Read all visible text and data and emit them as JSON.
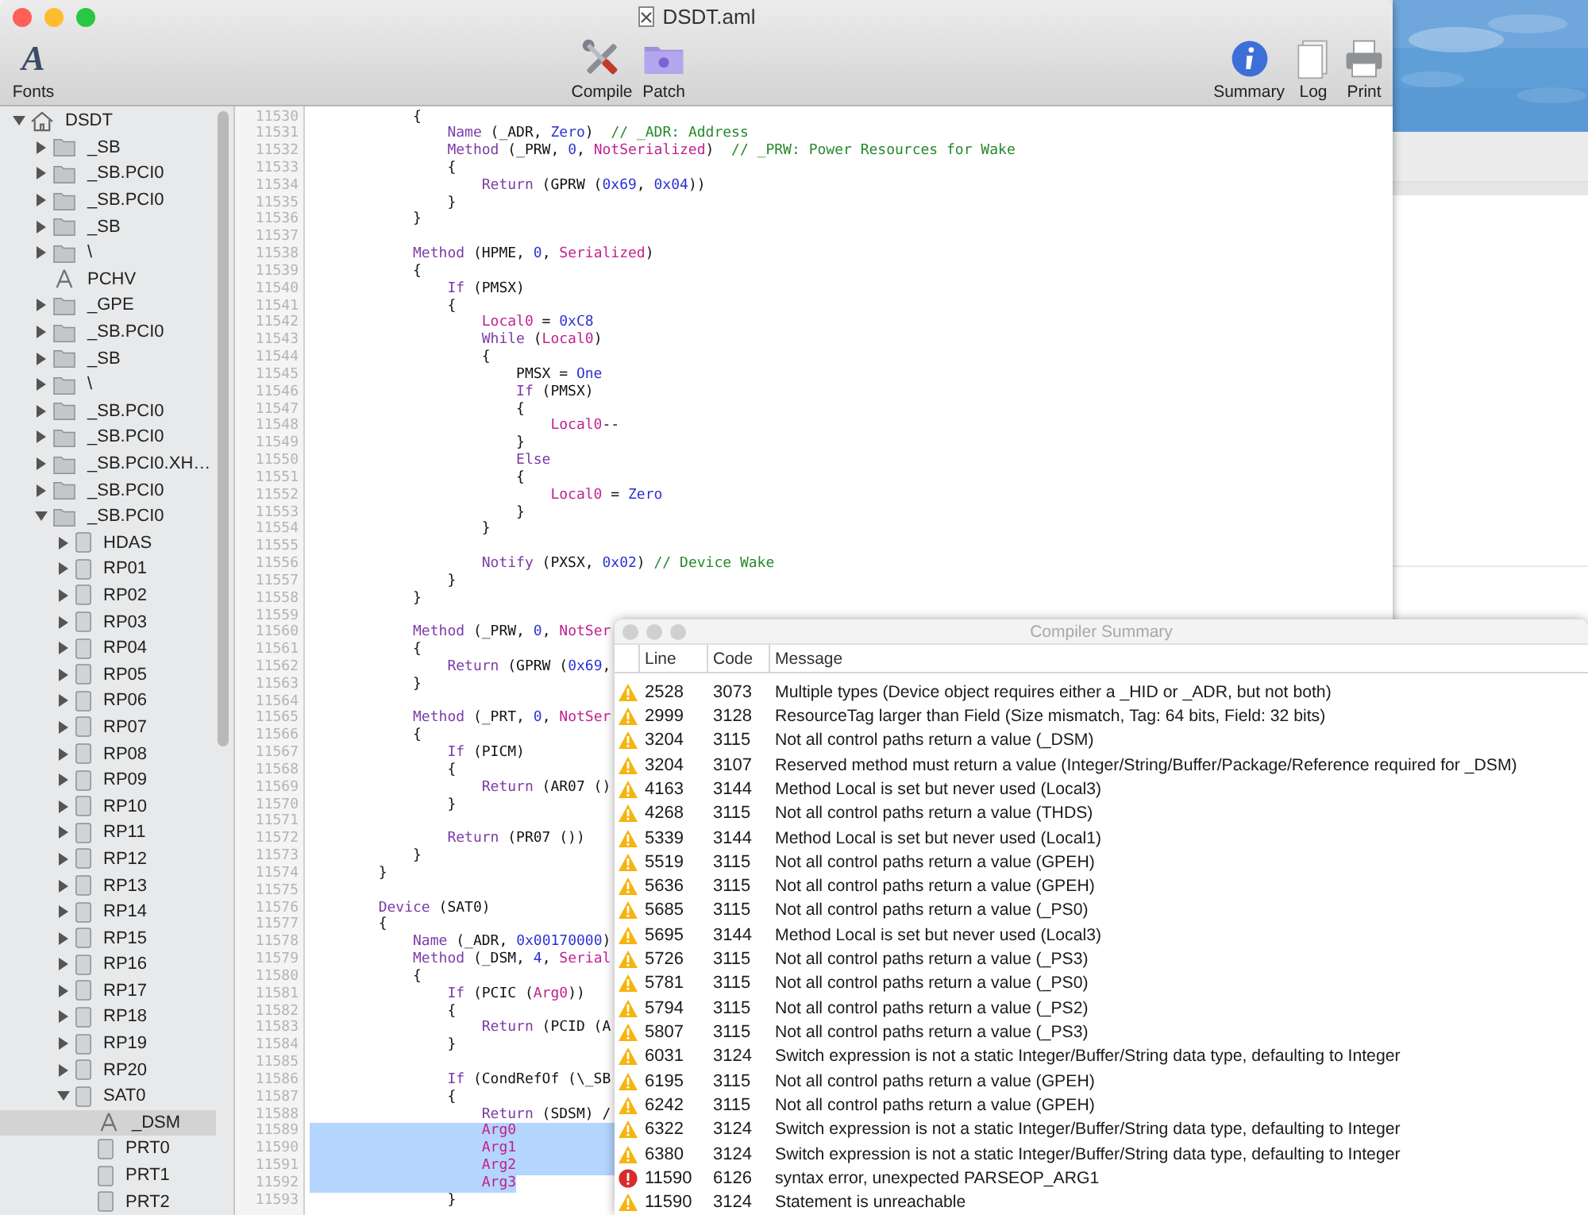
{
  "window": {
    "title": "DSDT.aml",
    "active": true
  },
  "toolbar": {
    "left": [
      {
        "kind": "fonts",
        "glyph": "A",
        "label": "Fonts"
      }
    ],
    "center": [
      {
        "kind": "compile",
        "label": "Compile"
      },
      {
        "kind": "patch",
        "label": "Patch"
      }
    ],
    "right": [
      {
        "kind": "summary",
        "label": "Summary"
      },
      {
        "kind": "log",
        "label": "Log"
      },
      {
        "kind": "print",
        "label": "Print"
      }
    ]
  },
  "sidebar": {
    "items": [
      {
        "label": "DSDT",
        "kind": "root",
        "expanded": true,
        "selected": false,
        "children": [
          {
            "label": "_SB",
            "kind": "folder",
            "expanded": false,
            "selected": false
          },
          {
            "label": "_SB.PCI0",
            "kind": "folder",
            "expanded": false,
            "selected": false
          },
          {
            "label": "_SB.PCI0",
            "kind": "folder",
            "expanded": false,
            "selected": false
          },
          {
            "label": "_SB",
            "kind": "folder",
            "expanded": false,
            "selected": false
          },
          {
            "label": "\\",
            "kind": "folder",
            "expanded": false,
            "selected": false
          },
          {
            "label": "PCHV",
            "kind": "method",
            "selected": false
          },
          {
            "label": "_GPE",
            "kind": "folder",
            "expanded": false,
            "selected": false
          },
          {
            "label": "_SB.PCI0",
            "kind": "folder",
            "expanded": false,
            "selected": false
          },
          {
            "label": "_SB",
            "kind": "folder",
            "expanded": false,
            "selected": false
          },
          {
            "label": "\\",
            "kind": "folder",
            "expanded": false,
            "selected": false
          },
          {
            "label": "_SB.PCI0",
            "kind": "folder",
            "expanded": false,
            "selected": false
          },
          {
            "label": "_SB.PCI0",
            "kind": "folder",
            "expanded": false,
            "selected": false
          },
          {
            "label": "_SB.PCI0.XH…",
            "kind": "folder",
            "expanded": false,
            "selected": false
          },
          {
            "label": "_SB.PCI0",
            "kind": "folder",
            "expanded": false,
            "selected": false
          },
          {
            "label": "_SB.PCI0",
            "kind": "folder",
            "expanded": true,
            "selected": false,
            "children": [
              {
                "label": "HDAS",
                "kind": "device",
                "expanded": false,
                "selected": false
              },
              {
                "label": "RP01",
                "kind": "device",
                "expanded": false,
                "selected": false
              },
              {
                "label": "RP02",
                "kind": "device",
                "expanded": false,
                "selected": false
              },
              {
                "label": "RP03",
                "kind": "device",
                "expanded": false,
                "selected": false
              },
              {
                "label": "RP04",
                "kind": "device",
                "expanded": false,
                "selected": false
              },
              {
                "label": "RP05",
                "kind": "device",
                "expanded": false,
                "selected": false
              },
              {
                "label": "RP06",
                "kind": "device",
                "expanded": false,
                "selected": false
              },
              {
                "label": "RP07",
                "kind": "device",
                "expanded": false,
                "selected": false
              },
              {
                "label": "RP08",
                "kind": "device",
                "expanded": false,
                "selected": false
              },
              {
                "label": "RP09",
                "kind": "device",
                "expanded": false,
                "selected": false
              },
              {
                "label": "RP10",
                "kind": "device",
                "expanded": false,
                "selected": false
              },
              {
                "label": "RP11",
                "kind": "device",
                "expanded": false,
                "selected": false
              },
              {
                "label": "RP12",
                "kind": "device",
                "expanded": false,
                "selected": false
              },
              {
                "label": "RP13",
                "kind": "device",
                "expanded": false,
                "selected": false
              },
              {
                "label": "RP14",
                "kind": "device",
                "expanded": false,
                "selected": false
              },
              {
                "label": "RP15",
                "kind": "device",
                "expanded": false,
                "selected": false
              },
              {
                "label": "RP16",
                "kind": "device",
                "expanded": false,
                "selected": false
              },
              {
                "label": "RP17",
                "kind": "device",
                "expanded": false,
                "selected": false
              },
              {
                "label": "RP18",
                "kind": "device",
                "expanded": false,
                "selected": false
              },
              {
                "label": "RP19",
                "kind": "device",
                "expanded": false,
                "selected": false
              },
              {
                "label": "RP20",
                "kind": "device",
                "expanded": false,
                "selected": false
              },
              {
                "label": "SAT0",
                "kind": "device",
                "expanded": true,
                "selected": false,
                "children": [
                  {
                    "label": "_DSM",
                    "kind": "method",
                    "selected": true
                  },
                  {
                    "label": "PRT0",
                    "kind": "device",
                    "selected": false
                  },
                  {
                    "label": "PRT1",
                    "kind": "device",
                    "selected": false
                  },
                  {
                    "label": "PRT2",
                    "kind": "device",
                    "selected": false
                  }
                ]
              }
            ]
          }
        ]
      }
    ]
  },
  "editor": {
    "lines": [
      {
        "number": "11530",
        "selected": false,
        "tokens": [
          {
            "kind": "plain",
            "text": "            {"
          }
        ]
      },
      {
        "number": "11531",
        "selected": false,
        "tokens": [
          {
            "kind": "keyword",
            "text": "                Name"
          },
          {
            "kind": "plain",
            "text": " (_ADR, "
          },
          {
            "kind": "number",
            "text": "Zero"
          },
          {
            "kind": "plain",
            "text": ")  "
          },
          {
            "kind": "comment",
            "text": "// _ADR: Address"
          }
        ]
      },
      {
        "number": "11532",
        "selected": false,
        "tokens": [
          {
            "kind": "keyword",
            "text": "                Method"
          },
          {
            "kind": "plain",
            "text": " (_PRW, "
          },
          {
            "kind": "number",
            "text": "0"
          },
          {
            "kind": "plain",
            "text": ", "
          },
          {
            "kind": "variable",
            "text": "NotSerialized"
          },
          {
            "kind": "plain",
            "text": ")  "
          },
          {
            "kind": "comment",
            "text": "// _PRW: Power Resources for Wake"
          }
        ]
      },
      {
        "number": "11533",
        "selected": false,
        "tokens": [
          {
            "kind": "plain",
            "text": "                {"
          }
        ]
      },
      {
        "number": "11534",
        "selected": false,
        "tokens": [
          {
            "kind": "keyword",
            "text": "                    Return"
          },
          {
            "kind": "plain",
            "text": " (GPRW ("
          },
          {
            "kind": "number",
            "text": "0x69"
          },
          {
            "kind": "plain",
            "text": ", "
          },
          {
            "kind": "number",
            "text": "0x04"
          },
          {
            "kind": "plain",
            "text": "))"
          }
        ]
      },
      {
        "number": "11535",
        "selected": false,
        "tokens": [
          {
            "kind": "plain",
            "text": "                }"
          }
        ]
      },
      {
        "number": "11536",
        "selected": false,
        "tokens": [
          {
            "kind": "plain",
            "text": "            }"
          }
        ]
      },
      {
        "number": "11537",
        "selected": false
      },
      {
        "number": "11538",
        "selected": false,
        "tokens": [
          {
            "kind": "keyword",
            "text": "            Method"
          },
          {
            "kind": "plain",
            "text": " (HPME, "
          },
          {
            "kind": "number",
            "text": "0"
          },
          {
            "kind": "plain",
            "text": ", "
          },
          {
            "kind": "variable",
            "text": "Serialized"
          },
          {
            "kind": "plain",
            "text": ")"
          }
        ]
      },
      {
        "number": "11539",
        "selected": false,
        "tokens": [
          {
            "kind": "plain",
            "text": "            {"
          }
        ]
      },
      {
        "number": "11540",
        "selected": false,
        "tokens": [
          {
            "kind": "keyword",
            "text": "                If"
          },
          {
            "kind": "plain",
            "text": " (PMSX)"
          }
        ]
      },
      {
        "number": "11541",
        "selected": false,
        "tokens": [
          {
            "kind": "plain",
            "text": "                {"
          }
        ]
      },
      {
        "number": "11542",
        "selected": false,
        "tokens": [
          {
            "kind": "variable",
            "text": "                    Local0"
          },
          {
            "kind": "plain",
            "text": " = "
          },
          {
            "kind": "number",
            "text": "0xC8"
          }
        ]
      },
      {
        "number": "11543",
        "selected": false,
        "tokens": [
          {
            "kind": "keyword",
            "text": "                    While"
          },
          {
            "kind": "plain",
            "text": " ("
          },
          {
            "kind": "variable",
            "text": "Local0"
          },
          {
            "kind": "plain",
            "text": ")"
          }
        ]
      },
      {
        "number": "11544",
        "selected": false,
        "tokens": [
          {
            "kind": "plain",
            "text": "                    {"
          }
        ]
      },
      {
        "number": "11545",
        "selected": false,
        "tokens": [
          {
            "kind": "plain",
            "text": "                        PMSX = "
          },
          {
            "kind": "number",
            "text": "One"
          }
        ]
      },
      {
        "number": "11546",
        "selected": false,
        "tokens": [
          {
            "kind": "keyword",
            "text": "                        If"
          },
          {
            "kind": "plain",
            "text": " (PMSX)"
          }
        ]
      },
      {
        "number": "11547",
        "selected": false,
        "tokens": [
          {
            "kind": "plain",
            "text": "                        {"
          }
        ]
      },
      {
        "number": "11548",
        "selected": false,
        "tokens": [
          {
            "kind": "variable",
            "text": "                            Local0"
          },
          {
            "kind": "plain",
            "text": "--"
          }
        ]
      },
      {
        "number": "11549",
        "selected": false,
        "tokens": [
          {
            "kind": "plain",
            "text": "                        }"
          }
        ]
      },
      {
        "number": "11550",
        "selected": false,
        "tokens": [
          {
            "kind": "keyword",
            "text": "                        Else"
          }
        ]
      },
      {
        "number": "11551",
        "selected": false,
        "tokens": [
          {
            "kind": "plain",
            "text": "                        {"
          }
        ]
      },
      {
        "number": "11552",
        "selected": false,
        "tokens": [
          {
            "kind": "variable",
            "text": "                            Local0"
          },
          {
            "kind": "plain",
            "text": " = "
          },
          {
            "kind": "number",
            "text": "Zero"
          }
        ]
      },
      {
        "number": "11553",
        "selected": false,
        "tokens": [
          {
            "kind": "plain",
            "text": "                        }"
          }
        ]
      },
      {
        "number": "11554",
        "selected": false,
        "tokens": [
          {
            "kind": "plain",
            "text": "                    }"
          }
        ]
      },
      {
        "number": "11555",
        "selected": false
      },
      {
        "number": "11556",
        "selected": false,
        "tokens": [
          {
            "kind": "keyword",
            "text": "                    Notify"
          },
          {
            "kind": "plain",
            "text": " (PXSX, "
          },
          {
            "kind": "number",
            "text": "0x02"
          },
          {
            "kind": "plain",
            "text": ") "
          },
          {
            "kind": "comment",
            "text": "// Device Wake"
          }
        ]
      },
      {
        "number": "11557",
        "selected": false,
        "tokens": [
          {
            "kind": "plain",
            "text": "                }"
          }
        ]
      },
      {
        "number": "11558",
        "selected": false,
        "tokens": [
          {
            "kind": "plain",
            "text": "            }"
          }
        ]
      },
      {
        "number": "11559",
        "selected": false
      },
      {
        "number": "11560",
        "selected": false,
        "tokens": [
          {
            "kind": "keyword",
            "text": "            Method"
          },
          {
            "kind": "plain",
            "text": " (_PRW, "
          },
          {
            "kind": "number",
            "text": "0"
          },
          {
            "kind": "plain",
            "text": ", "
          },
          {
            "kind": "variable",
            "text": "NotSer"
          }
        ]
      },
      {
        "number": "11561",
        "selected": false,
        "tokens": [
          {
            "kind": "plain",
            "text": "            {"
          }
        ]
      },
      {
        "number": "11562",
        "selected": false,
        "tokens": [
          {
            "kind": "keyword",
            "text": "                Return"
          },
          {
            "kind": "plain",
            "text": " (GPRW ("
          },
          {
            "kind": "number",
            "text": "0x69"
          },
          {
            "kind": "plain",
            "text": ","
          }
        ]
      },
      {
        "number": "11563",
        "selected": false,
        "tokens": [
          {
            "kind": "plain",
            "text": "            }"
          }
        ]
      },
      {
        "number": "11564",
        "selected": false
      },
      {
        "number": "11565",
        "selected": false,
        "tokens": [
          {
            "kind": "keyword",
            "text": "            Method"
          },
          {
            "kind": "plain",
            "text": " (_PRT, "
          },
          {
            "kind": "number",
            "text": "0"
          },
          {
            "kind": "plain",
            "text": ", "
          },
          {
            "kind": "variable",
            "text": "NotSer"
          }
        ]
      },
      {
        "number": "11566",
        "selected": false,
        "tokens": [
          {
            "kind": "plain",
            "text": "            {"
          }
        ]
      },
      {
        "number": "11567",
        "selected": false,
        "tokens": [
          {
            "kind": "keyword",
            "text": "                If"
          },
          {
            "kind": "plain",
            "text": " (PICM)"
          }
        ]
      },
      {
        "number": "11568",
        "selected": false,
        "tokens": [
          {
            "kind": "plain",
            "text": "                {"
          }
        ]
      },
      {
        "number": "11569",
        "selected": false,
        "tokens": [
          {
            "kind": "keyword",
            "text": "                    Return"
          },
          {
            "kind": "plain",
            "text": " (AR07 ()"
          }
        ]
      },
      {
        "number": "11570",
        "selected": false,
        "tokens": [
          {
            "kind": "plain",
            "text": "                }"
          }
        ]
      },
      {
        "number": "11571",
        "selected": false
      },
      {
        "number": "11572",
        "selected": false,
        "tokens": [
          {
            "kind": "keyword",
            "text": "                Return"
          },
          {
            "kind": "plain",
            "text": " (PR07 ())"
          }
        ]
      },
      {
        "number": "11573",
        "selected": false,
        "tokens": [
          {
            "kind": "plain",
            "text": "            }"
          }
        ]
      },
      {
        "number": "11574",
        "selected": false,
        "tokens": [
          {
            "kind": "plain",
            "text": "        }"
          }
        ]
      },
      {
        "number": "11575",
        "selected": false
      },
      {
        "number": "11576",
        "selected": false,
        "tokens": [
          {
            "kind": "keyword",
            "text": "        Device"
          },
          {
            "kind": "plain",
            "text": " (SAT0)"
          }
        ]
      },
      {
        "number": "11577",
        "selected": false,
        "tokens": [
          {
            "kind": "plain",
            "text": "        {"
          }
        ]
      },
      {
        "number": "11578",
        "selected": false,
        "tokens": [
          {
            "kind": "keyword",
            "text": "            Name"
          },
          {
            "kind": "plain",
            "text": " (_ADR, "
          },
          {
            "kind": "number",
            "text": "0x00170000"
          },
          {
            "kind": "plain",
            "text": ")"
          }
        ]
      },
      {
        "number": "11579",
        "selected": false,
        "tokens": [
          {
            "kind": "keyword",
            "text": "            Method"
          },
          {
            "kind": "plain",
            "text": " (_DSM, "
          },
          {
            "kind": "number",
            "text": "4"
          },
          {
            "kind": "plain",
            "text": ", "
          },
          {
            "kind": "variable",
            "text": "Serial"
          }
        ]
      },
      {
        "number": "11580",
        "selected": false,
        "tokens": [
          {
            "kind": "plain",
            "text": "            {"
          }
        ]
      },
      {
        "number": "11581",
        "selected": false,
        "tokens": [
          {
            "kind": "keyword",
            "text": "                If"
          },
          {
            "kind": "plain",
            "text": " (PCIC ("
          },
          {
            "kind": "variable",
            "text": "Arg0"
          },
          {
            "kind": "plain",
            "text": "))"
          }
        ]
      },
      {
        "number": "11582",
        "selected": false,
        "tokens": [
          {
            "kind": "plain",
            "text": "                {"
          }
        ]
      },
      {
        "number": "11583",
        "selected": false,
        "tokens": [
          {
            "kind": "keyword",
            "text": "                    Return"
          },
          {
            "kind": "plain",
            "text": " (PCID (A"
          }
        ]
      },
      {
        "number": "11584",
        "selected": false,
        "tokens": [
          {
            "kind": "plain",
            "text": "                }"
          }
        ]
      },
      {
        "number": "11585",
        "selected": false
      },
      {
        "number": "11586",
        "selected": false,
        "tokens": [
          {
            "kind": "keyword",
            "text": "                If"
          },
          {
            "kind": "plain",
            "text": " (CondRefOf (\\_SB"
          }
        ]
      },
      {
        "number": "11587",
        "selected": false,
        "tokens": [
          {
            "kind": "plain",
            "text": "                {"
          }
        ]
      },
      {
        "number": "11588",
        "selected": false,
        "tokens": [
          {
            "kind": "keyword",
            "text": "                    Return"
          },
          {
            "kind": "plain",
            "text": " (SDSM) /"
          }
        ]
      },
      {
        "number": "11589",
        "selected": true,
        "tokens": [
          {
            "kind": "variable",
            "text": "                    Arg0"
          }
        ]
      },
      {
        "number": "11590",
        "selected": true,
        "tokens": [
          {
            "kind": "variable",
            "text": "                    Arg1"
          }
        ]
      },
      {
        "number": "11591",
        "selected": true,
        "tokens": [
          {
            "kind": "variable",
            "text": "                    Arg2"
          }
        ]
      },
      {
        "number": "11592",
        "selected": true,
        "tokens": [
          {
            "kind": "variable",
            "text": "                    Arg3"
          }
        ]
      },
      {
        "number": "11593",
        "selected": false,
        "tokens": [
          {
            "kind": "plain",
            "text": "                }"
          }
        ]
      }
    ]
  },
  "summary": {
    "title": "Compiler Summary",
    "active": false,
    "columns": [
      "Line",
      "Code",
      "Message"
    ],
    "rows": [
      {
        "kind": "warning",
        "line": "2528",
        "code": "3073",
        "message": "Multiple types (Device object requires either a _HID or _ADR, but not both)"
      },
      {
        "kind": "warning",
        "line": "2999",
        "code": "3128",
        "message": "ResourceTag larger than Field (Size mismatch, Tag: 64 bits, Field: 32 bits)"
      },
      {
        "kind": "warning",
        "line": "3204",
        "code": "3115",
        "message": "Not all control paths return a value (_DSM)"
      },
      {
        "kind": "warning",
        "line": "3204",
        "code": "3107",
        "message": "Reserved method must return a value (Integer/String/Buffer/Package/Reference required for _DSM)"
      },
      {
        "kind": "warning",
        "line": "4163",
        "code": "3144",
        "message": "Method Local is set but never used (Local3)"
      },
      {
        "kind": "warning",
        "line": "4268",
        "code": "3115",
        "message": "Not all control paths return a value (THDS)"
      },
      {
        "kind": "warning",
        "line": "5339",
        "code": "3144",
        "message": "Method Local is set but never used (Local1)"
      },
      {
        "kind": "warning",
        "line": "5519",
        "code": "3115",
        "message": "Not all control paths return a value (GPEH)"
      },
      {
        "kind": "warning",
        "line": "5636",
        "code": "3115",
        "message": "Not all control paths return a value (GPEH)"
      },
      {
        "kind": "warning",
        "line": "5685",
        "code": "3115",
        "message": "Not all control paths return a value (_PS0)"
      },
      {
        "kind": "warning",
        "line": "5695",
        "code": "3144",
        "message": "Method Local is set but never used (Local3)"
      },
      {
        "kind": "warning",
        "line": "5726",
        "code": "3115",
        "message": "Not all control paths return a value (_PS3)"
      },
      {
        "kind": "warning",
        "line": "5781",
        "code": "3115",
        "message": "Not all control paths return a value (_PS0)"
      },
      {
        "kind": "warning",
        "line": "5794",
        "code": "3115",
        "message": "Not all control paths return a value (_PS2)"
      },
      {
        "kind": "warning",
        "line": "5807",
        "code": "3115",
        "message": "Not all control paths return a value (_PS3)"
      },
      {
        "kind": "warning",
        "line": "6031",
        "code": "3124",
        "message": "Switch expression is not a static Integer/Buffer/String data type, defaulting to Integer"
      },
      {
        "kind": "warning",
        "line": "6195",
        "code": "3115",
        "message": "Not all control paths return a value (GPEH)"
      },
      {
        "kind": "warning",
        "line": "6242",
        "code": "3115",
        "message": "Not all control paths return a value (GPEH)"
      },
      {
        "kind": "warning",
        "line": "6322",
        "code": "3124",
        "message": "Switch expression is not a static Integer/Buffer/String data type, defaulting to Integer"
      },
      {
        "kind": "warning",
        "line": "6380",
        "code": "3124",
        "message": "Switch expression is not a static Integer/Buffer/String data type, defaulting to Integer"
      },
      {
        "kind": "error",
        "line": "11590",
        "code": "6126",
        "message": "syntax error, unexpected PARSEOP_ARG1"
      },
      {
        "kind": "warning",
        "line": "11590",
        "code": "3124",
        "message": "Statement is unreachable"
      }
    ]
  }
}
